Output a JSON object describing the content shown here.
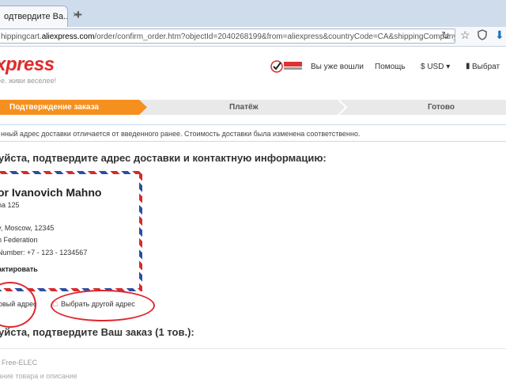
{
  "browser": {
    "tab_title": "одтвердите Ва...",
    "tab_close": "×",
    "new_tab": "+",
    "url_pre": "hippingcart.",
    "url_host": "aliexpress.com",
    "url_post": "/order/confirm_order.htm?objectId=2040268199&from=aliexpress&countryCode=CA&shippingCompany=DHL"
  },
  "header": {
    "logo": "ixpress",
    "slogan": "ее. живи веселее!",
    "login": "Вы уже вошли",
    "help": "Помощь",
    "currency": "$ USD ▾",
    "lang": "Выбрат"
  },
  "steps": [
    {
      "label": "Подтверждение заказа",
      "active": true
    },
    {
      "label": "Платёж",
      "active": false
    },
    {
      "label": "Готово",
      "active": false
    }
  ],
  "notice": "нный адрес доставки отличается от введенного ранее. Стоимость доставки была изменена соответственно.",
  "address_section": {
    "heading": "уйста, подтвердите адрес доставки и контактную информацию:",
    "name": "or Ivanovich Mahno",
    "street": "na 125",
    "city": "y, Moscow, 12345",
    "country": "n Federation",
    "phone": "Number: +7   - 123 - 1234567",
    "edit": "актировать",
    "new_address": "овый адрес",
    "other_address": "Выбрать другой адрес"
  },
  "order_section": {
    "heading": "уйста, подтвердите Ваш заказ (1 тов.):",
    "seller": ": Free-ELEC",
    "product_hint": "ание товара и описание"
  },
  "colors": {
    "accent": "#f5901e",
    "brand": "#e12a2a",
    "annotation": "#e0262f"
  }
}
